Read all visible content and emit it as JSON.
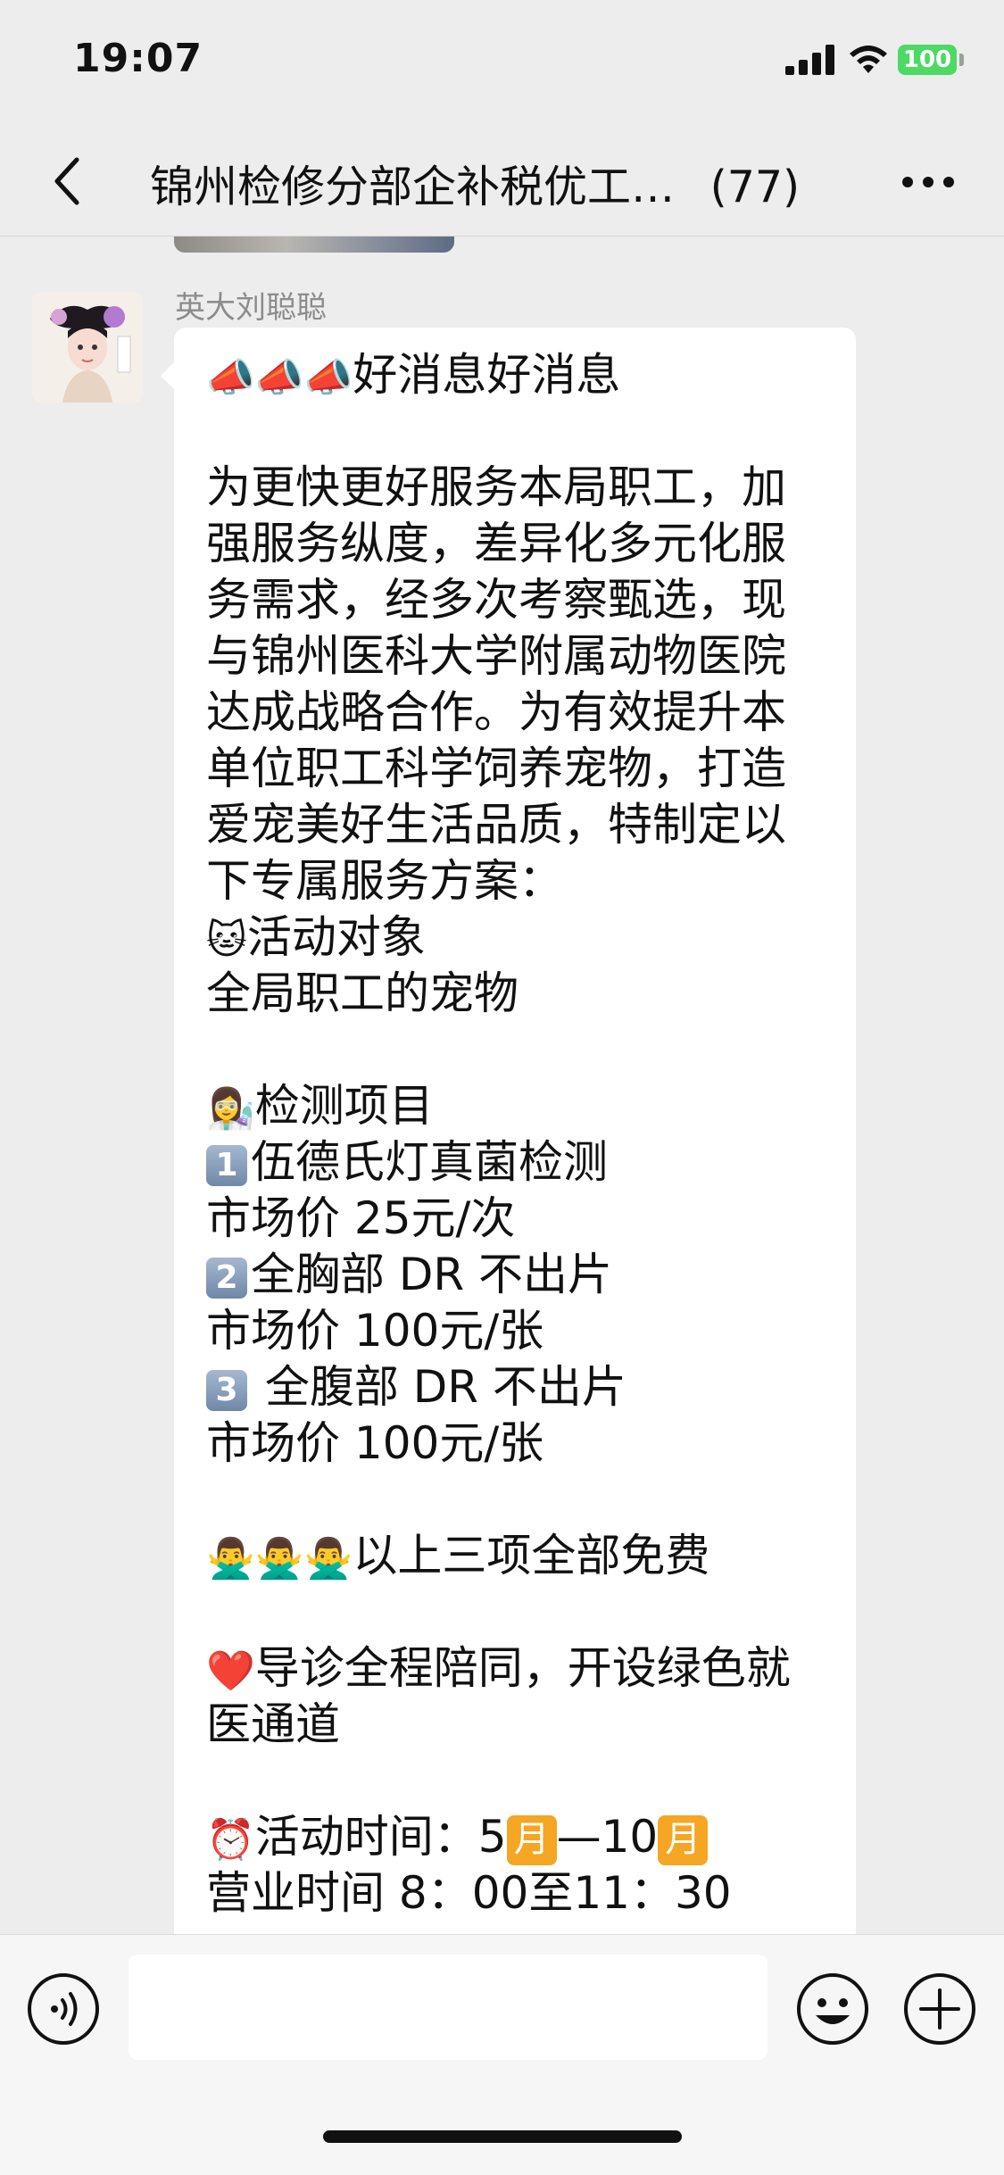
{
  "status_bar": {
    "time": "19:07",
    "battery": "100"
  },
  "nav": {
    "title": "锦州检修分部企补税优工…",
    "count": "(77)"
  },
  "message": {
    "sender": "英大刘聪聪",
    "lines": [
      {
        "emoji": "📣📣📣",
        "text": "好消息好消息"
      },
      {
        "text": ""
      },
      {
        "text": "为更快更好服务本局职工，加"
      },
      {
        "text": "强服务纵度，差异化多元化服"
      },
      {
        "text": "务需求，经多次考察甄选，现"
      },
      {
        "text": "与锦州医科大学附属动物医院"
      },
      {
        "text": "达成战略合作。为有效提升本"
      },
      {
        "text": "单位职工科学饲养宠物，打造"
      },
      {
        "text": "爱宠美好生活品质，特制定以"
      },
      {
        "text": "下专属服务方案："
      },
      {
        "emoji": "🐱",
        "text": "活动对象"
      },
      {
        "text": "  全局职工的宠物"
      },
      {
        "text": ""
      },
      {
        "emoji": "👩‍🔬",
        "text": "检测项目"
      },
      {
        "key": "1",
        "text": "伍德氏灯真菌检测"
      },
      {
        "text": "市场价 25元/次"
      },
      {
        "key": "2",
        "text": "全胸部 DR   不出片"
      },
      {
        "text": "市场价 100元/张"
      },
      {
        "key": "3",
        "text": " 全腹部 DR 不出片"
      },
      {
        "text": "市场价 100元/张"
      },
      {
        "text": ""
      },
      {
        "emoji": "🙅‍♂️🙅‍♂️🙅‍♂️",
        "text": "以上三项全部免费"
      },
      {
        "text": ""
      },
      {
        "emoji": "❤️",
        "text": "导诊全程陪同，开设绿色就"
      },
      {
        "text": "医通道"
      },
      {
        "text": ""
      },
      {
        "emoji": "⏰",
        "text": "活动时间：5",
        "badge1": "月",
        "mid": "—10",
        "badge2": "月"
      },
      {
        "text": " 营业时间 8：00至11：30"
      }
    ]
  },
  "input": {
    "placeholder": ""
  },
  "colors": {
    "background": "#ededed",
    "bubble": "#ffffff",
    "battery": "#4cd964",
    "month_badge": "#f5a623"
  },
  "icons": [
    "back-icon",
    "more-icon",
    "voice-icon",
    "emoji-icon",
    "plus-icon",
    "signal-icon",
    "wifi-icon"
  ]
}
